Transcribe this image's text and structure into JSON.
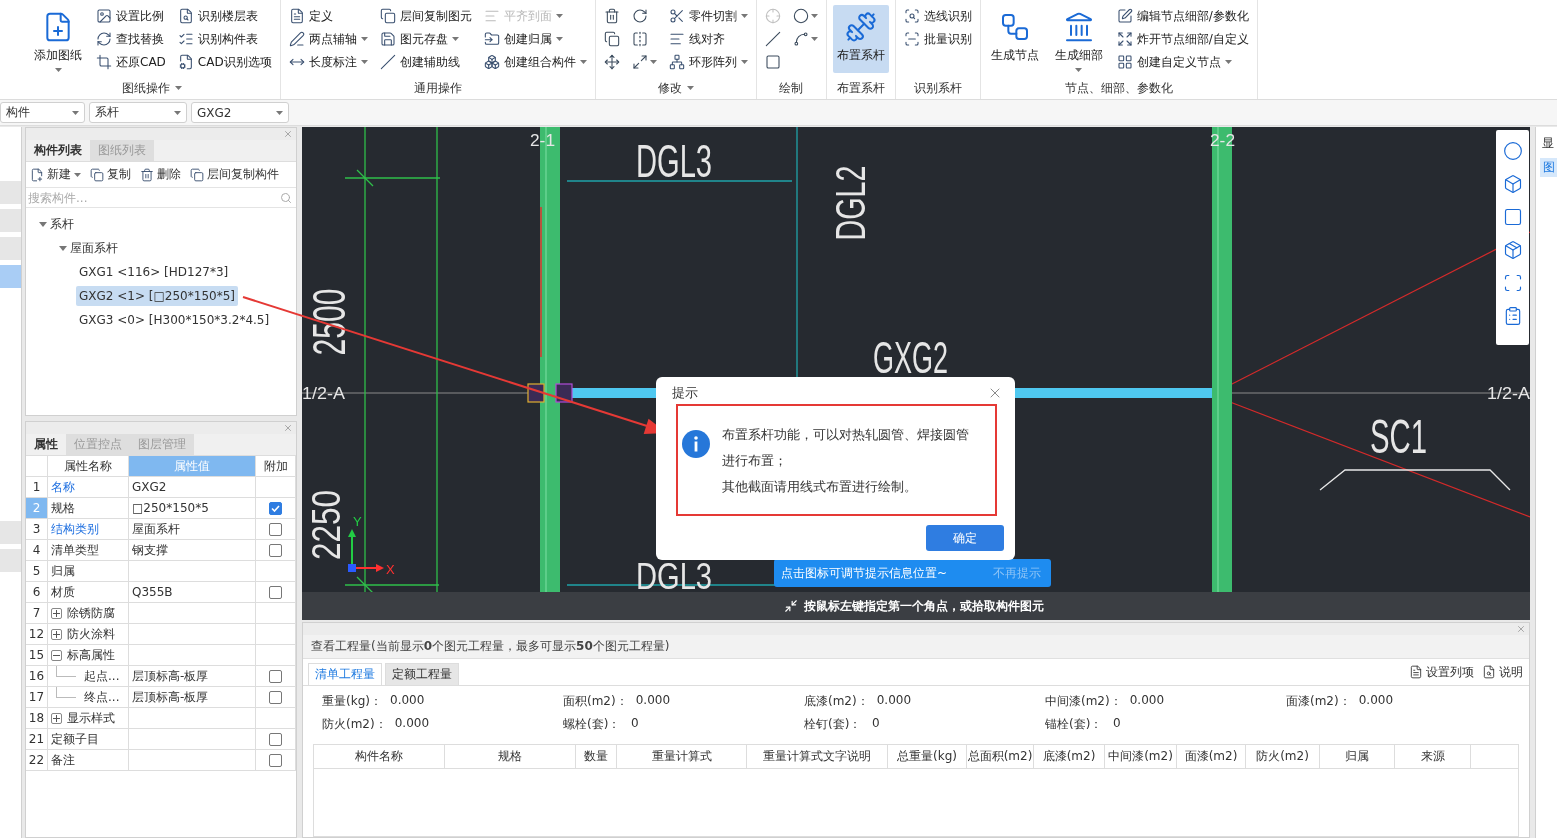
{
  "ribbon": {
    "groups": [
      {
        "title": "图纸操作",
        "menu": true,
        "columns": [
          [
            {
              "label": "添加图纸",
              "kind": "large",
              "caret": true,
              "disabled": false,
              "selected": false
            }
          ],
          [
            {
              "label": "设置比例",
              "kind": "small",
              "caret": false,
              "disabled": false,
              "selected": false
            },
            {
              "label": "查找替换",
              "kind": "small",
              "caret": false,
              "disabled": false,
              "selected": false
            },
            {
              "label": "还原CAD",
              "kind": "small",
              "caret": false,
              "disabled": false,
              "selected": false
            }
          ],
          [
            {
              "label": "识别楼层表",
              "kind": "small",
              "caret": false,
              "disabled": false,
              "selected": false
            },
            {
              "label": "识别构件表",
              "kind": "small",
              "caret": false,
              "disabled": false,
              "selected": false
            },
            {
              "label": "CAD识别选项",
              "kind": "small",
              "caret": false,
              "disabled": false,
              "selected": false
            }
          ]
        ]
      },
      {
        "title": "通用操作",
        "menu": false,
        "columns": [
          [
            {
              "label": "定义",
              "kind": "small",
              "caret": false,
              "disabled": false,
              "selected": false
            },
            {
              "label": "两点辅轴",
              "kind": "small",
              "caret": true,
              "disabled": false,
              "selected": false
            },
            {
              "label": "长度标注",
              "kind": "small",
              "caret": true,
              "disabled": false,
              "selected": false
            }
          ],
          [
            {
              "label": "层间复制图元",
              "kind": "small",
              "caret": false,
              "disabled": false,
              "selected": false
            },
            {
              "label": "图元存盘",
              "kind": "small",
              "caret": true,
              "disabled": false,
              "selected": false
            },
            {
              "label": "创建辅助线",
              "kind": "small",
              "caret": false,
              "disabled": false,
              "selected": false
            }
          ],
          [
            {
              "label": "平齐到面",
              "kind": "small",
              "caret": true,
              "disabled": true,
              "selected": false
            },
            {
              "label": "创建归属",
              "kind": "small",
              "caret": true,
              "disabled": false,
              "selected": false
            },
            {
              "label": "创建组合构件",
              "kind": "small",
              "caret": true,
              "disabled": false,
              "selected": false
            }
          ]
        ]
      },
      {
        "title": "修改",
        "menu": true,
        "columns": [
          [
            {
              "kind": "icon",
              "caret": false,
              "disabled": false,
              "selected": false
            },
            {
              "kind": "icon",
              "caret": false,
              "disabled": false,
              "selected": false
            },
            {
              "kind": "icon",
              "caret": false,
              "disabled": false,
              "selected": false
            }
          ],
          [
            {
              "kind": "icon",
              "caret": false,
              "disabled": false,
              "selected": false
            },
            {
              "kind": "icon",
              "caret": false,
              "disabled": false,
              "selected": false
            },
            {
              "kind": "icon",
              "caret": true,
              "disabled": false,
              "selected": false
            }
          ],
          [
            {
              "label": "零件切割",
              "kind": "small",
              "caret": true,
              "disabled": false,
              "selected": false
            },
            {
              "label": "线对齐",
              "kind": "small",
              "caret": false,
              "disabled": false,
              "selected": false
            },
            {
              "label": "环形阵列",
              "kind": "small",
              "caret": true,
              "disabled": false,
              "selected": false
            }
          ]
        ]
      },
      {
        "title": "绘制",
        "menu": false,
        "columns": [
          [
            {
              "kind": "icon",
              "caret": false,
              "disabled": true,
              "selected": false
            },
            {
              "kind": "icon",
              "caret": false,
              "disabled": false,
              "selected": false
            },
            {
              "kind": "icon",
              "caret": false,
              "disabled": false,
              "selected": false
            }
          ],
          [
            {
              "kind": "icon",
              "caret": true,
              "disabled": false,
              "selected": false
            },
            {
              "kind": "icon",
              "caret": true,
              "disabled": false,
              "selected": false
            }
          ]
        ]
      },
      {
        "title": "布置系杆",
        "menu": false,
        "columns": [
          [
            {
              "label": "布置系杆",
              "kind": "large",
              "caret": false,
              "disabled": false,
              "selected": true
            }
          ]
        ]
      },
      {
        "title": "识别系杆",
        "menu": false,
        "columns": [
          [
            {
              "label": "选线识别",
              "kind": "small",
              "caret": false,
              "disabled": false,
              "selected": false
            },
            {
              "label": "批量识别",
              "kind": "small",
              "caret": false,
              "disabled": false,
              "selected": false
            }
          ]
        ]
      },
      {
        "title": "节点、细部、参数化",
        "menu": false,
        "columns": [
          [
            {
              "label": "生成节点",
              "kind": "large",
              "caret": false,
              "disabled": false,
              "selected": false
            }
          ],
          [
            {
              "label": "生成细部",
              "kind": "large",
              "caret": true,
              "disabled": false,
              "selected": false
            }
          ],
          [
            {
              "label": "编辑节点细部/参数化",
              "kind": "small",
              "caret": false,
              "disabled": false,
              "selected": false
            },
            {
              "label": "炸开节点细部/自定义",
              "kind": "small",
              "caret": false,
              "disabled": false,
              "selected": false
            },
            {
              "label": "创建自定义节点",
              "kind": "small",
              "caret": true,
              "disabled": false,
              "selected": false
            }
          ]
        ]
      }
    ]
  },
  "selectors": [
    "构件",
    "系杆",
    "GXG2"
  ],
  "left_strip": {
    "items": [
      {
        "selected": false
      },
      {
        "selected": false
      },
      {
        "selected": false
      },
      {
        "selected": true
      },
      {
        "selected": false
      },
      {
        "selected": false
      }
    ]
  },
  "component_panel": {
    "tabs": [
      {
        "label": "构件列表",
        "selected": true
      },
      {
        "label": "图纸列表",
        "selected": false
      }
    ],
    "toolbar": [
      {
        "label": "新建",
        "caret": true
      },
      {
        "label": "复制",
        "caret": false
      },
      {
        "label": "删除",
        "caret": false
      },
      {
        "label": "层间复制构件",
        "caret": false
      }
    ],
    "search": {
      "placeholder": "搜索构件..."
    },
    "tree": [
      {
        "label": "系杆",
        "expanded": true,
        "selected": false,
        "children": [
          {
            "label": "屋面系杆",
            "expanded": true,
            "selected": false,
            "children": [
              {
                "label": "GXG1 <116> [HD127*3]",
                "selected": false
              },
              {
                "label": "GXG2 <1> [□250*150*5]",
                "selected": true
              },
              {
                "label": "GXG3 <0> [H300*150*3.2*4.5]",
                "selected": false
              }
            ]
          }
        ]
      }
    ]
  },
  "property_panel": {
    "tabs": [
      {
        "label": "属性",
        "selected": true
      },
      {
        "label": "位置控点",
        "selected": false
      },
      {
        "label": "图层管理",
        "selected": false
      }
    ],
    "columns": [
      {
        "label": "属性名称",
        "selected": false
      },
      {
        "label": "属性值",
        "selected": true
      },
      {
        "label": "附加",
        "selected": false
      }
    ],
    "rows": [
      {
        "no": "1",
        "name": "名称",
        "value": "GXG2",
        "kind": "plain",
        "link": true,
        "selected": false
      },
      {
        "no": "2",
        "name": "规格",
        "value": "□250*150*5",
        "kind": "plain",
        "link": false,
        "selected": true,
        "checked": true
      },
      {
        "no": "3",
        "name": "结构类别",
        "value": "屋面系杆",
        "kind": "plain",
        "link": true,
        "selected": false,
        "checked": false
      },
      {
        "no": "4",
        "name": "清单类型",
        "value": "钢支撑",
        "kind": "plain",
        "link": false,
        "selected": false,
        "checked": false
      },
      {
        "no": "5",
        "name": "归属",
        "kind": "plain",
        "link": false,
        "selected": false
      },
      {
        "no": "6",
        "name": "材质",
        "value": "Q355B",
        "kind": "plain",
        "link": false,
        "selected": false,
        "checked": false
      },
      {
        "no": "7",
        "name": "除锈防腐",
        "kind": "group",
        "expanded": false,
        "link": false,
        "selected": false
      },
      {
        "no": "12",
        "name": "防火涂料",
        "kind": "group",
        "expanded": false,
        "link": false,
        "selected": false
      },
      {
        "no": "15",
        "name": "标高属性",
        "kind": "group",
        "expanded": true,
        "link": false,
        "selected": false
      },
      {
        "no": "16",
        "name": "起点...",
        "value": "层顶标高-板厚",
        "kind": "child",
        "link": false,
        "selected": false,
        "checked": false
      },
      {
        "no": "17",
        "name": "终点...",
        "value": "层顶标高-板厚",
        "kind": "child",
        "link": false,
        "selected": false,
        "checked": false
      },
      {
        "no": "18",
        "name": "显示样式",
        "kind": "group",
        "expanded": false,
        "link": false,
        "selected": false
      },
      {
        "no": "21",
        "name": "定额子目",
        "kind": "plain",
        "link": false,
        "selected": false,
        "checked": false
      },
      {
        "no": "22",
        "name": "备注",
        "kind": "plain",
        "link": false,
        "selected": false,
        "checked": false
      }
    ]
  },
  "canvas": {
    "labels": [
      "2-1",
      "DGL3",
      "DGL2",
      "2-2",
      "2500",
      "2250",
      "GXG2",
      "1/2-A",
      "1/2-A",
      "SC1",
      "DGL3",
      "Y",
      "X"
    ],
    "dialog": {
      "title": "提示",
      "message": [
        "布置系杆功能，可以对热轧圆管、焊接圆管进行布置；",
        "其他截面请用线式布置进行绘制。"
      ],
      "button": "确定"
    },
    "tip": {
      "text": "点击图标可调节提示信息位置~",
      "action": "不再提示"
    },
    "status": "按鼠标左键指定第一个角点，或拾取构件图元"
  },
  "quantity_panel": {
    "title": "查看工程量(当前显示**0**个图元工程量，最多可显示**50**个图元工程量)",
    "tabs": [
      {
        "label": "清单工程量",
        "selected": true
      },
      {
        "label": "定额工程量",
        "selected": false
      }
    ],
    "links": [
      "设置列项",
      "说明"
    ],
    "stats": [
      [
        {
          "label": "重量(kg)：",
          "value": "0.000"
        },
        {
          "label": "面积(m2)：",
          "value": "0.000"
        },
        {
          "label": "底漆(m2)：",
          "value": "0.000"
        },
        {
          "label": "中间漆(m2)：",
          "value": "0.000"
        },
        {
          "label": "面漆(m2)：",
          "value": "0.000"
        }
      ],
      [
        {
          "label": "防火(m2)：",
          "value": "0.000"
        },
        {
          "label": "螺栓(套)：",
          "value": "0"
        },
        {
          "label": "栓钉(套)：",
          "value": "0"
        },
        {
          "label": "锚栓(套)：",
          "value": "0"
        }
      ]
    ],
    "columns": [
      "构件名称",
      "规格",
      "数量",
      "重量计算式",
      "重量计算式文字说明",
      "总重量(kg)",
      "总面积(m2)",
      "底漆(m2)",
      "中间漆(m2)",
      "面漆(m2)",
      "防火(m2)",
      "归属",
      "来源"
    ]
  },
  "right_strip": {
    "title": "显",
    "tab": "图"
  }
}
